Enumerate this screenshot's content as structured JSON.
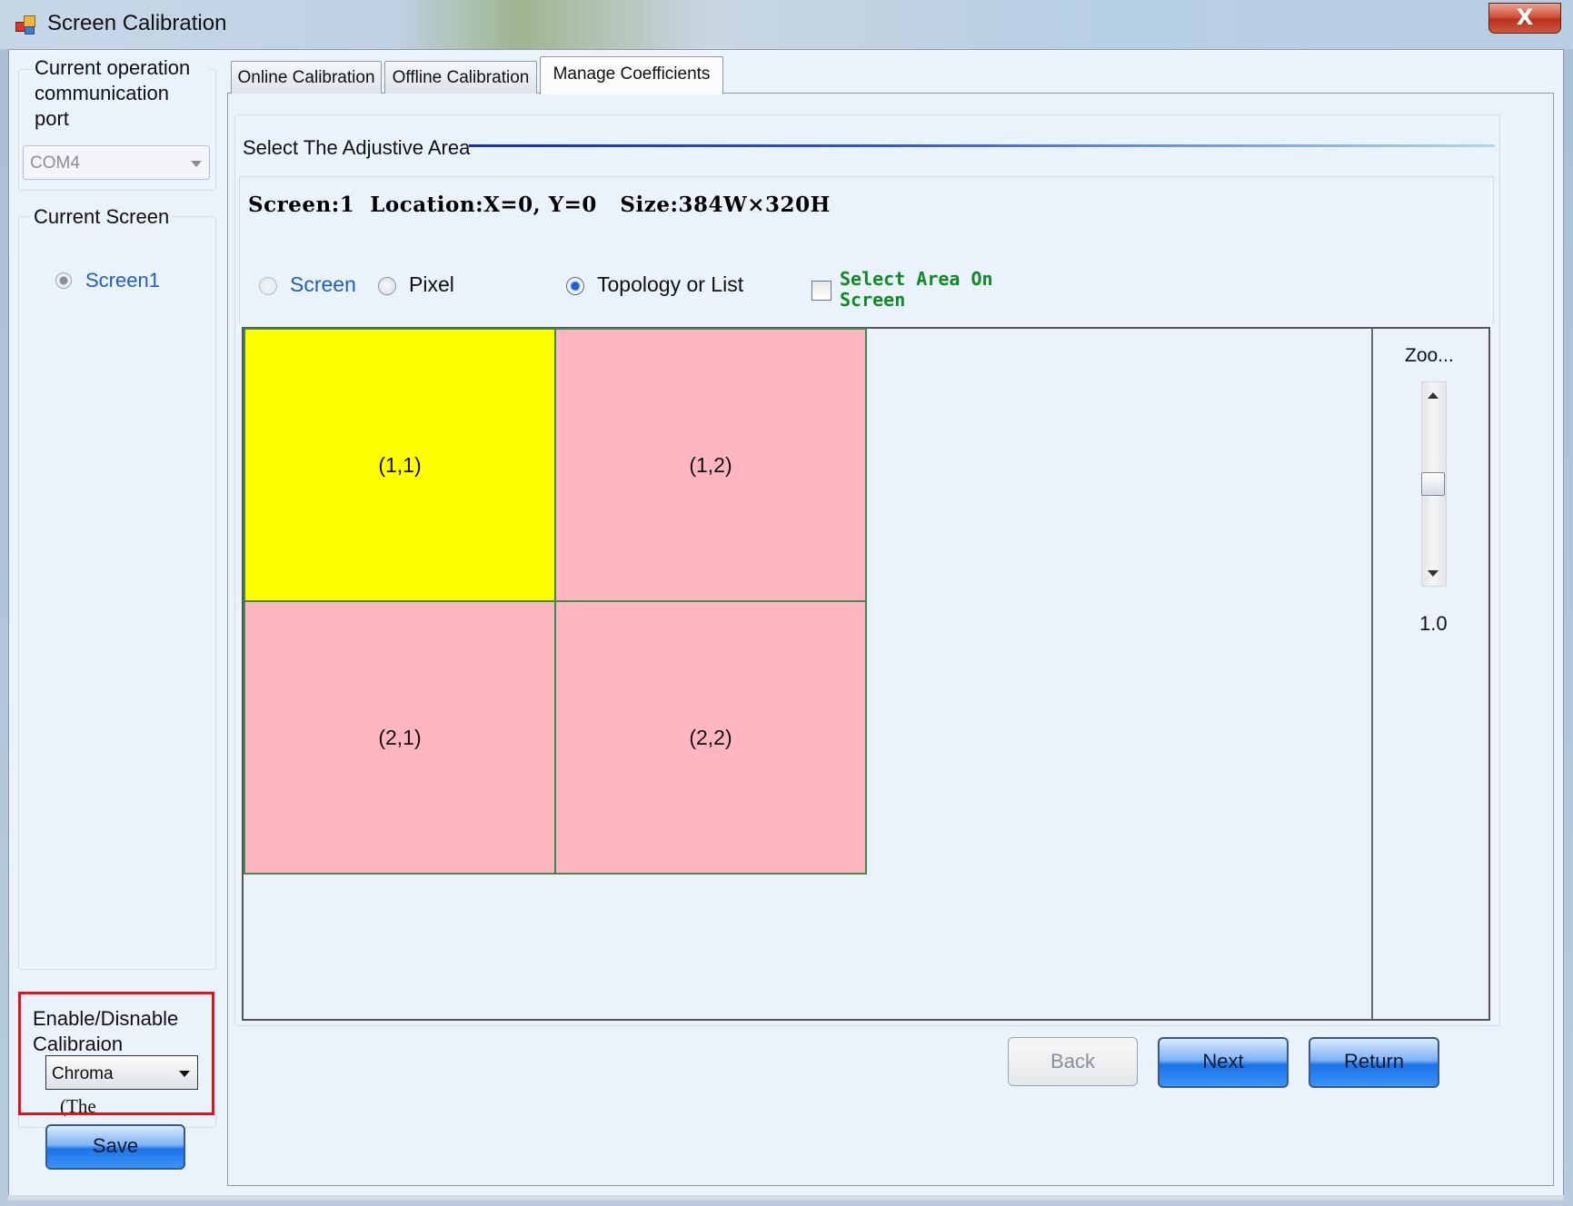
{
  "window": {
    "title": "Screen Calibration",
    "close_glyph": "X"
  },
  "left": {
    "port_group_label": "Current operation communication port",
    "port_value": "COM4",
    "screen_group_label": "Current Screen",
    "screen_item": "Screen1",
    "enable_label": "Enable/Disnable Calibraion",
    "enable_value": "Chroma",
    "enable_note": "(The",
    "save_label": "Save"
  },
  "tabs": [
    {
      "label": "Online Calibration"
    },
    {
      "label": "Offline Calibration"
    },
    {
      "label": "Manage Coefficients",
      "active": true
    }
  ],
  "area": {
    "title": "Select The Adjustive Area",
    "info": "Screen:1  Location:X=0, Y=0   Size:384W×320H",
    "radio_screen": "Screen",
    "radio_pixel": "Pixel",
    "radio_topology": "Topology or List",
    "selected_mode": "Topology or List",
    "checkbox_label": "Select Area On Screen",
    "checkbox_checked": false
  },
  "grid": {
    "cells": [
      {
        "label": "(1,1)",
        "color": "#ffff00",
        "selected": true
      },
      {
        "label": "(1,2)",
        "color": "#ffb6c1",
        "selected": false
      },
      {
        "label": "(2,1)",
        "color": "#ffb6c1",
        "selected": false
      },
      {
        "label": "(2,2)",
        "color": "#ffb6c1",
        "selected": false
      }
    ]
  },
  "zoom": {
    "label": "Zoo...",
    "value": "1.0"
  },
  "buttons": {
    "back": "Back",
    "next": "Next",
    "return": "Return"
  },
  "colors": {
    "accent_blue": "#1a73e8",
    "highlight_red": "#e0141c",
    "selected_cell": "#ffff00",
    "cell": "#ffb6c1",
    "checkbox_label": "#118a24"
  }
}
